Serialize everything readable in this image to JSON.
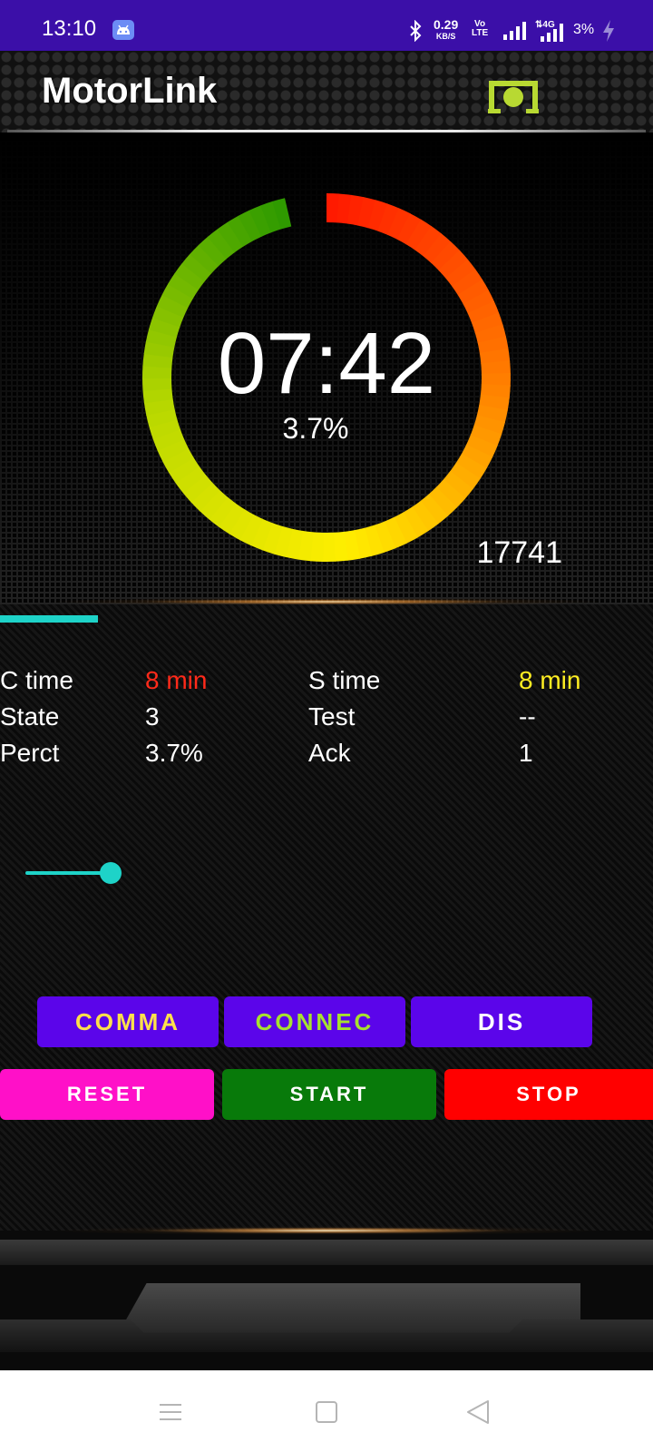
{
  "status_bar": {
    "time": "13:10",
    "net_speed": "0.29",
    "net_unit": "KB/S",
    "volte_top": "Vo",
    "volte_bottom": "LTE",
    "network": "4G",
    "battery": "3%",
    "icons": [
      "android-notification-icon",
      "bluetooth-icon",
      "signal-icon",
      "signal-4g-icon",
      "charging-icon"
    ]
  },
  "header": {
    "title": "MotorLink",
    "device_icon": "bluetooth-device-icon",
    "accent_color": "#b8d932"
  },
  "gauge": {
    "time": "07:42",
    "percent_label": "3.7%",
    "fill_fraction": 0.963,
    "count": "17741",
    "gradient_colors": [
      "#ff1a00",
      "#ff7a00",
      "#ffee00",
      "#b9d800",
      "#2f9a00"
    ]
  },
  "progress": {
    "fraction": 0.15,
    "color": "#1ed3c8"
  },
  "info": {
    "rows": [
      {
        "label1": "C time",
        "value1": "8 min",
        "value1_color": "#ff2a1a",
        "label2": "S time",
        "value2": "8 min",
        "value2_color": "#ffee22"
      },
      {
        "label1": "State",
        "value1": "3",
        "value1_color": "#ffffff",
        "label2": "Test",
        "value2": "--",
        "value2_color": "#ffffff"
      },
      {
        "label1": "Perct",
        "value1": "3.7%",
        "value1_color": "#ffffff",
        "label2": "Ack",
        "value2": "1",
        "value2_color": "#ffffff"
      }
    ]
  },
  "slider": {
    "value": 0.85,
    "color": "#1ed3c8"
  },
  "buttons": {
    "comma": {
      "label": "COMMA",
      "text_color": "#ffe14a"
    },
    "connect": {
      "label": "CONNEC",
      "text_color": "#a6e22e"
    },
    "disconnect": {
      "label": "DIS",
      "text_color": "#ffffff"
    },
    "reset": {
      "label": "RESET",
      "bg": "#ff10c8"
    },
    "start": {
      "label": "START",
      "bg": "#087a0a"
    },
    "stop": {
      "label": "STOP",
      "bg": "#ff0000"
    }
  },
  "nav_bar": {
    "icons": [
      "menu-icon",
      "home-square-icon",
      "back-triangle-icon"
    ]
  }
}
